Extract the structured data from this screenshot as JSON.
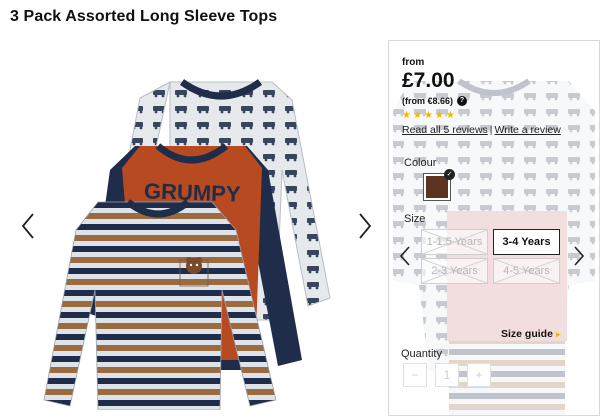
{
  "product": {
    "title": "3 Pack Assorted Long Sleeve Tops"
  },
  "image_text": {
    "slogan": "GRUMPY"
  },
  "pricing": {
    "from_label": "from",
    "price": "£7.00",
    "alt_price": "(from €8.66)"
  },
  "reviews": {
    "rating": 5,
    "max_rating": 5,
    "stars": [
      "★",
      "★",
      "★",
      "★",
      "★"
    ],
    "read_label": "Read all 5 reviews",
    "separator": "|",
    "write_label": "Write a review"
  },
  "colour": {
    "label": "Colour",
    "selected_hex": "#5c3420"
  },
  "size": {
    "label": "Size",
    "options": [
      {
        "label": "1-1.5 Years",
        "available": false,
        "selected": false
      },
      {
        "label": "3-4 Years",
        "available": true,
        "selected": true
      },
      {
        "label": "2-3 Years",
        "available": false,
        "selected": false
      },
      {
        "label": "4-5 Years",
        "available": false,
        "selected": false
      }
    ],
    "guide_label": "Size guide",
    "guide_icon": "chevron-right-icon"
  },
  "quantity": {
    "label": "Quantity",
    "decrement": "−",
    "value": "1",
    "increment": "+"
  },
  "icons": {
    "help": "?",
    "check": "✓"
  },
  "colors": {
    "accent": "#f2b705",
    "text": "#111111",
    "shirt_orange": "#b84a22",
    "shirt_navy": "#1f2d4a",
    "stripe_brown": "#9a6b3f",
    "stripe_grey": "#dde3e8"
  }
}
